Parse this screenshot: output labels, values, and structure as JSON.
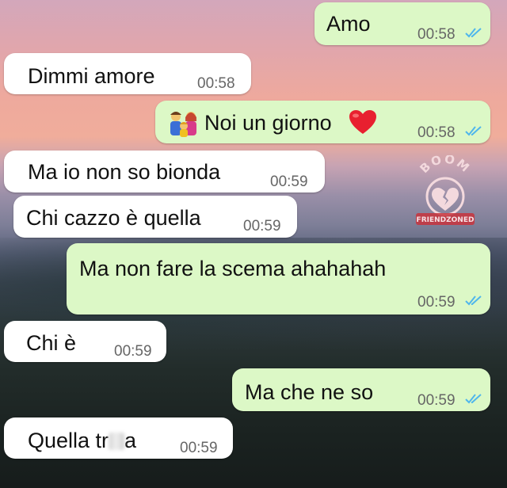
{
  "messages": [
    {
      "text": "Amo",
      "time": "00:58",
      "direction": "out",
      "status": "read"
    },
    {
      "text": "Dimmi amore",
      "time": "00:58",
      "direction": "in"
    },
    {
      "text": "Noi un giorno",
      "time": "00:58",
      "direction": "out",
      "status": "read",
      "leading_emoji": "family-emoji",
      "trailing_emoji": "heart-emoji"
    },
    {
      "text": "Ma io non so bionda",
      "time": "00:59",
      "direction": "in"
    },
    {
      "text": "Chi cazzo è quella",
      "time": "00:59",
      "direction": "in"
    },
    {
      "text": "Ma non fare la scema ahahahah",
      "time": "00:59",
      "direction": "out",
      "status": "read"
    },
    {
      "text": "Chi è",
      "time": "00:59",
      "direction": "in"
    },
    {
      "text": "Ma che ne so",
      "time": "00:59",
      "direction": "out",
      "status": "read"
    },
    {
      "text_before": "Quella tr",
      "text_after": "a",
      "time": "00:59",
      "direction": "in",
      "censored": true
    }
  ],
  "watermark": {
    "top_text": "BOOM",
    "bottom_text": "FRIENDZONED",
    "icon": "broken-heart-icon"
  },
  "colors": {
    "outgoing_bubble": "#dcf8c6",
    "incoming_bubble": "#ffffff",
    "read_ticks": "#4fb6ec",
    "heart": "#e8202f"
  }
}
